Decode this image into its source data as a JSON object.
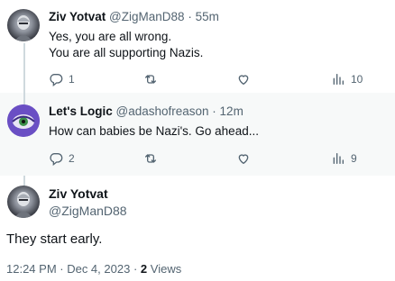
{
  "reply1": {
    "name": "Ziv Yotvat",
    "handle": "@ZigManD88",
    "time": "55m",
    "lines": [
      "Yes, you are all wrong.",
      "You are all supporting Nazis."
    ],
    "replies": "1",
    "views": "10"
  },
  "reply2": {
    "name": "Let's Logic",
    "handle": "@adashofreason",
    "time": "12m",
    "text": "How can babies be Nazi's. Go ahead...",
    "replies": "2",
    "views": "9"
  },
  "main_tweet": {
    "name": "Ziv Yotvat",
    "handle": "@ZigManD88",
    "text": "They start early.",
    "timestamp": "12:24 PM · Dec 4, 2023",
    "views_count": "2",
    "views_label": "Views"
  },
  "separator": "·",
  "icons": {
    "reply": "reply-icon",
    "retweet": "retweet-icon",
    "like": "like-icon",
    "views": "views-icon"
  },
  "colors": {
    "text": "#0f1419",
    "muted": "#536471",
    "thread_line": "#cfd9de",
    "highlight_bg": "#f7f9f9"
  }
}
